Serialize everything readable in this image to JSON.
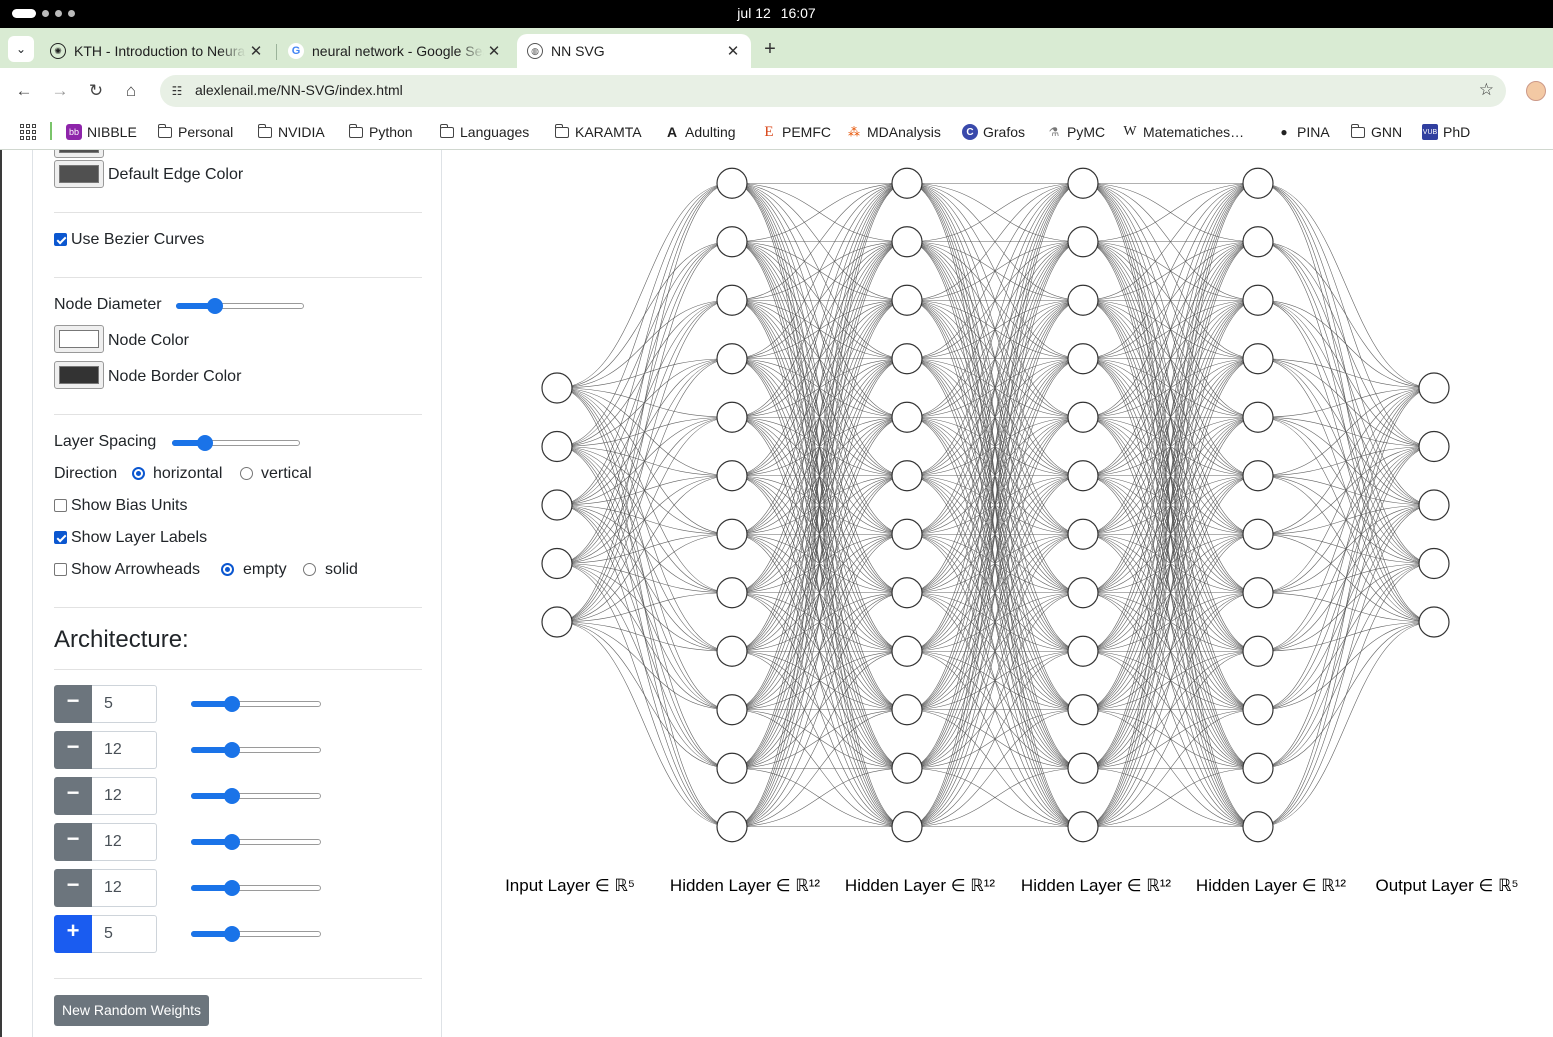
{
  "os": {
    "date": "jul 12",
    "time": "16:07"
  },
  "tabs": [
    {
      "title": "KTH - Introduction to Neural Networks",
      "icon": "openai-icon",
      "active": false
    },
    {
      "title": "neural network - Google Search",
      "icon": "google-icon",
      "active": false
    },
    {
      "title": "NN SVG",
      "icon": "globe-icon",
      "active": true
    }
  ],
  "address": {
    "url": "alexlenail.me/NN-SVG/index.html"
  },
  "bookmarks": [
    {
      "label": "NIBBLE",
      "icon": "nibble-icon"
    },
    {
      "label": "Personal",
      "icon": "folder-icon"
    },
    {
      "label": "NVIDIA",
      "icon": "folder-icon"
    },
    {
      "label": "Python",
      "icon": "folder-icon"
    },
    {
      "label": "Languages",
      "icon": "folder-icon"
    },
    {
      "label": "KARAMTA",
      "icon": "folder-icon"
    },
    {
      "label": "Adulting",
      "icon": "adulting-icon"
    },
    {
      "label": "PEMFC",
      "icon": "pemfc-icon"
    },
    {
      "label": "MDAnalysis",
      "icon": "mdanalysis-icon"
    },
    {
      "label": "Grafos",
      "icon": "grafos-icon"
    },
    {
      "label": "PyMC",
      "icon": "pymc-icon"
    },
    {
      "label": "Matematiches…",
      "icon": "wikipedia-icon"
    },
    {
      "label": "PINA",
      "icon": "github-icon"
    },
    {
      "label": "GNN",
      "icon": "folder-icon"
    },
    {
      "label": "PhD",
      "icon": "vub-icon"
    }
  ],
  "sidebar": {
    "default_edge_color_label": "Default Edge Color",
    "default_edge_color": "#505050",
    "bezier_label": "Use Bezier Curves",
    "bezier_checked": true,
    "node_diameter_label": "Node Diameter",
    "node_diameter_value": 0.28,
    "node_color_label": "Node Color",
    "node_color": "#ffffff",
    "node_border_color_label": "Node Border Color",
    "node_border_color": "#333333",
    "layer_spacing_label": "Layer Spacing",
    "layer_spacing_value": 0.22,
    "direction_label": "Direction",
    "direction_horizontal": "horizontal",
    "direction_vertical": "vertical",
    "direction_selected": "horizontal",
    "show_bias_label": "Show Bias Units",
    "show_bias_checked": false,
    "show_labels_label": "Show Layer Labels",
    "show_labels_checked": true,
    "show_arrowheads_label": "Show Arrowheads",
    "show_arrowheads_checked": false,
    "arrow_empty": "empty",
    "arrow_solid": "solid",
    "arrow_selected": "empty",
    "architecture_title": "Architecture:",
    "layers": [
      {
        "value": "5",
        "button": "−",
        "slider": 0.29
      },
      {
        "value": "12",
        "button": "−",
        "slider": 0.29
      },
      {
        "value": "12",
        "button": "−",
        "slider": 0.29
      },
      {
        "value": "12",
        "button": "−",
        "slider": 0.29
      },
      {
        "value": "12",
        "button": "−",
        "slider": 0.29
      },
      {
        "value": "5",
        "button": "+",
        "slider": 0.29
      }
    ],
    "random_weights_label": "New Random Weights"
  },
  "network": {
    "layer_sizes": [
      5,
      12,
      12,
      12,
      12,
      5
    ],
    "labels": [
      "Input Layer ∈ ℝ⁵",
      "Hidden Layer ∈ ℝ¹²",
      "Hidden Layer ∈ ℝ¹²",
      "Hidden Layer ∈ ℝ¹²",
      "Hidden Layer ∈ ℝ¹²",
      "Output Layer ∈ ℝ⁵"
    ],
    "edge_color": "#505050",
    "node_fill": "#ffffff",
    "node_border": "#333333"
  }
}
